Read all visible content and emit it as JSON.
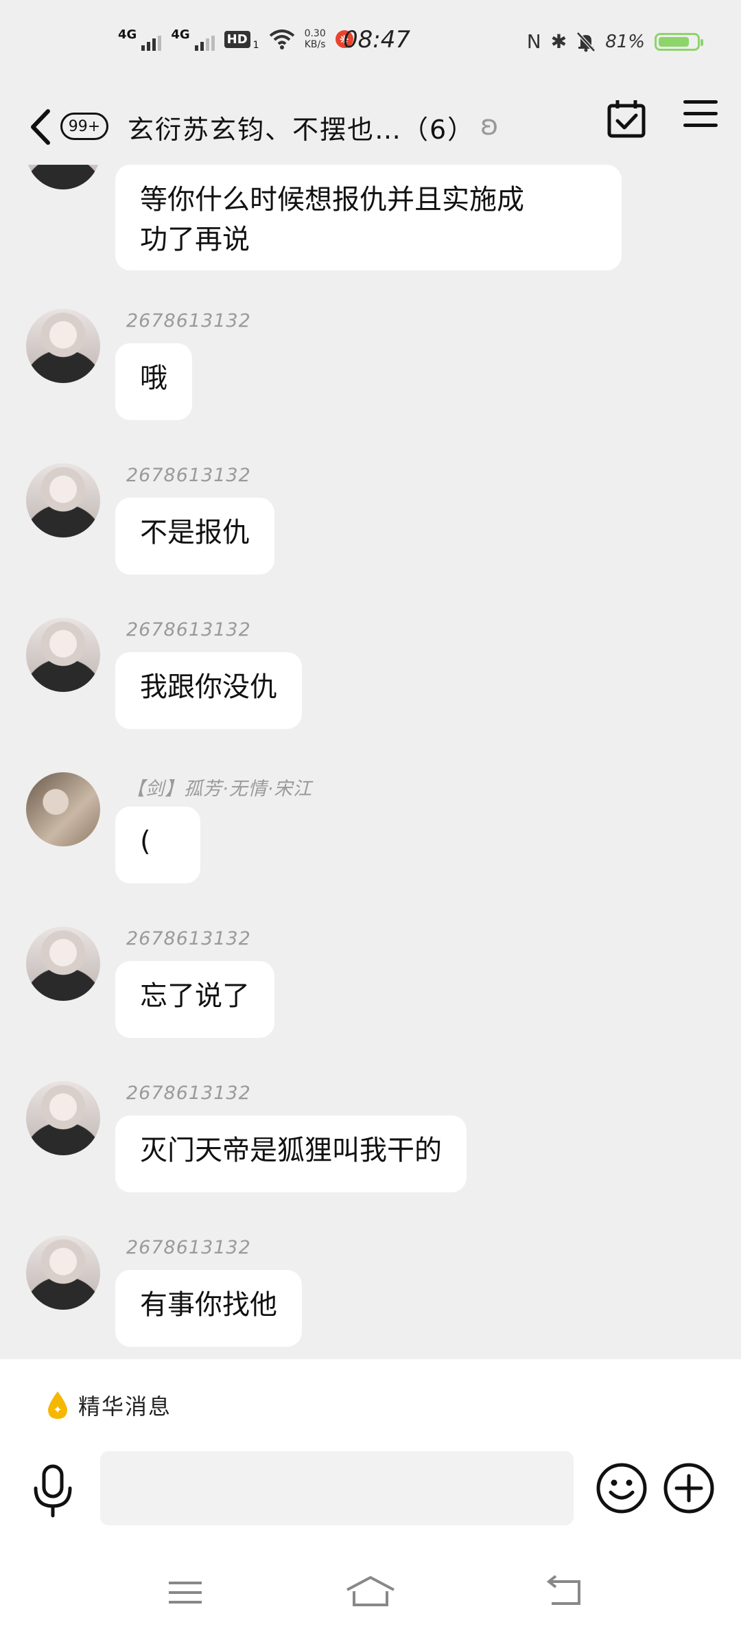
{
  "status_bar": {
    "net1": "4G",
    "net2": "4G",
    "hd": "HD",
    "hd_sub": "1",
    "speed_value": "0.30",
    "speed_unit": "KB/s",
    "app_icon_glyph": "❋",
    "time": "08:47",
    "nfc_icon": "N",
    "bluetooth_icon": "✱",
    "battery_percent": "81%",
    "battery_level": 0.81,
    "battery_color": "#8dd46a"
  },
  "header": {
    "unread_badge": "99+",
    "title": "玄衍苏玄钧、不摆也…（6）",
    "ear_icon": "ʚ"
  },
  "messages": [
    {
      "sender": "",
      "text": "等你什么时候想报仇并且实施成\n功了再说"
    },
    {
      "sender": "2678613132",
      "text": "哦"
    },
    {
      "sender": "2678613132",
      "text": "不是报仇"
    },
    {
      "sender": "2678613132",
      "text": "我跟你没仇"
    },
    {
      "sender": "【剑】孤芳·无情·宋江",
      "text": "("
    },
    {
      "sender": "2678613132",
      "text": "忘了说了"
    },
    {
      "sender": "2678613132",
      "text": "灭门天帝是狐狸叫我干的"
    },
    {
      "sender": "2678613132",
      "text": "有事你找他"
    }
  ],
  "bottom": {
    "essence_label": "精华消息",
    "essence_icon_glyph": "✦",
    "input_placeholder": ""
  },
  "colors": {
    "background": "#efefef",
    "bubble": "#ffffff",
    "nickname": "#9a9a9a",
    "essence_drop": "#f5b700"
  }
}
